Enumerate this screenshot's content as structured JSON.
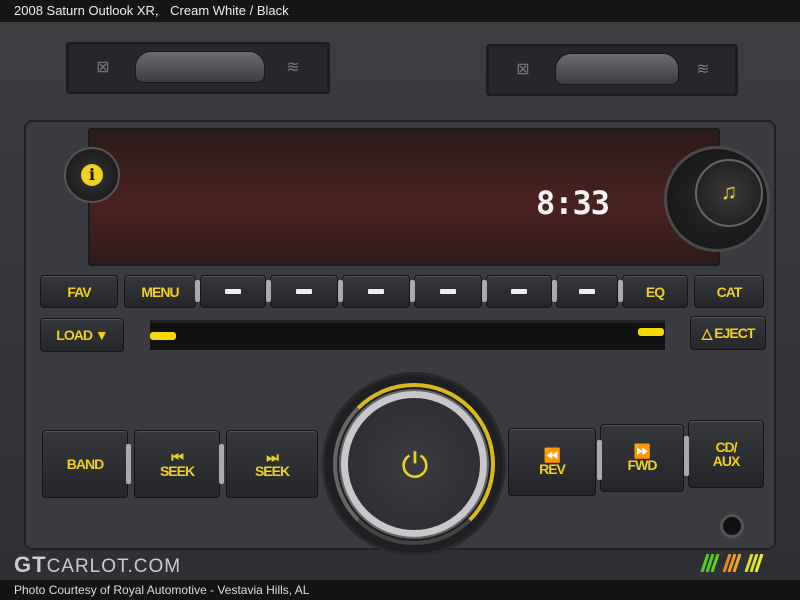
{
  "header": {
    "title": "2008 Saturn Outlook XR,",
    "color": "Cream White / Black"
  },
  "display": {
    "clock": "8:33"
  },
  "buttons": {
    "fav": "FAV",
    "menu": "MENU",
    "presets": [
      "—",
      "—",
      "—",
      "—",
      "—",
      "—"
    ],
    "eq": "EQ",
    "cat": "CAT",
    "load": "LOAD ▼",
    "eject": "△ EJECT",
    "band": "BAND",
    "seek_back": "SEEK",
    "seek_fwd": "SEEK",
    "rev": "REV",
    "fwd": "FWD",
    "cd_aux_1": "CD/",
    "cd_aux_2": "AUX"
  },
  "icons": {
    "info": "i",
    "music": "♫",
    "power": "⏻",
    "prev": "⏮",
    "next": "⏭",
    "rewind": "⏪",
    "ffwd": "⏩"
  },
  "watermark": {
    "gt": "GT",
    "rest": "CARLOT.COM"
  },
  "caption": "Photo Courtesy of Royal Automotive - Vestavia Hills, AL",
  "colors": {
    "button_text": "#f0d020",
    "clock": "#f4f4f4",
    "display": "#4a2220"
  }
}
